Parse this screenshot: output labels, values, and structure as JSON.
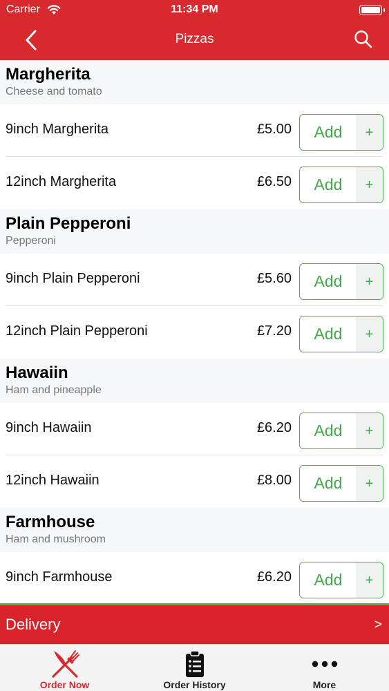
{
  "status_bar": {
    "carrier": "Carrier",
    "time": "11:34 PM"
  },
  "nav": {
    "title": "Pizzas",
    "back_icon": "chevron-left-icon",
    "search_icon": "search-icon"
  },
  "colors": {
    "brand_red": "#d7292e",
    "add_green": "#43a84b"
  },
  "menu": [
    {
      "title": "Margherita",
      "subtitle": "Cheese and tomato",
      "items": [
        {
          "name": "9inch Margherita",
          "price": "£5.00",
          "add_label": "Add",
          "plus": "+"
        },
        {
          "name": "12inch Margherita",
          "price": "£6.50",
          "add_label": "Add",
          "plus": "+"
        }
      ]
    },
    {
      "title": "Plain Pepperoni",
      "subtitle": "Pepperoni",
      "items": [
        {
          "name": "9inch Plain Pepperoni",
          "price": "£5.60",
          "add_label": "Add",
          "plus": "+"
        },
        {
          "name": "12inch Plain Pepperoni",
          "price": "£7.20",
          "add_label": "Add",
          "plus": "+"
        }
      ]
    },
    {
      "title": "Hawaiin",
      "subtitle": "Ham and pineapple",
      "items": [
        {
          "name": "9inch Hawaiin",
          "price": "£6.20",
          "add_label": "Add",
          "plus": "+"
        },
        {
          "name": "12inch Hawaiin",
          "price": "£8.00",
          "add_label": "Add",
          "plus": "+"
        }
      ]
    },
    {
      "title": "Farmhouse",
      "subtitle": "Ham and mushroom",
      "items": [
        {
          "name": "9inch Farmhouse",
          "price": "£6.20",
          "add_label": "Add",
          "plus": "+"
        }
      ]
    }
  ],
  "delivery": {
    "label": "Delivery",
    "arrow": ">"
  },
  "tabs": [
    {
      "label": "Order Now",
      "icon": "fork-knife-icon",
      "active": true
    },
    {
      "label": "Order History",
      "icon": "clipboard-list-icon",
      "active": false
    },
    {
      "label": "More",
      "icon": "more-dots-icon",
      "active": false
    }
  ]
}
